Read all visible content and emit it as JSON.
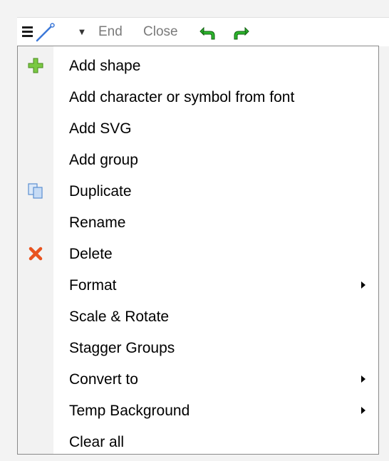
{
  "toolbar": {
    "end_label": "End",
    "close_label": "Close",
    "icons": [
      "hamburger-menu-icon",
      "pen-line-icon",
      "chevron-down-icon",
      "undo-icon",
      "redo-icon"
    ],
    "colors": {
      "undo_redo": "#2db52d",
      "pen": "#3c78d8"
    }
  },
  "menu": {
    "items": [
      {
        "label": "Add shape",
        "icon": "plus-icon",
        "submenu": false
      },
      {
        "label": "Add character or symbol from font",
        "icon": "",
        "submenu": false
      },
      {
        "label": "Add SVG",
        "icon": "",
        "submenu": false
      },
      {
        "label": "Add group",
        "icon": "",
        "submenu": false
      },
      {
        "label": "Duplicate",
        "icon": "copy-icon",
        "submenu": false
      },
      {
        "label": "Rename",
        "icon": "",
        "submenu": false
      },
      {
        "label": "Delete",
        "icon": "delete-x-icon",
        "submenu": false
      },
      {
        "label": "Format",
        "icon": "",
        "submenu": true
      },
      {
        "label": "Scale & Rotate",
        "icon": "",
        "submenu": false
      },
      {
        "label": "Stagger Groups",
        "icon": "",
        "submenu": false
      },
      {
        "label": "Convert to",
        "icon": "",
        "submenu": true
      },
      {
        "label": "Temp Background",
        "icon": "",
        "submenu": true
      },
      {
        "label": "Clear all",
        "icon": "",
        "submenu": false
      }
    ],
    "colors": {
      "plus": "#7ac943",
      "delete": "#e8531f",
      "copy": "#5b8fd1"
    }
  }
}
